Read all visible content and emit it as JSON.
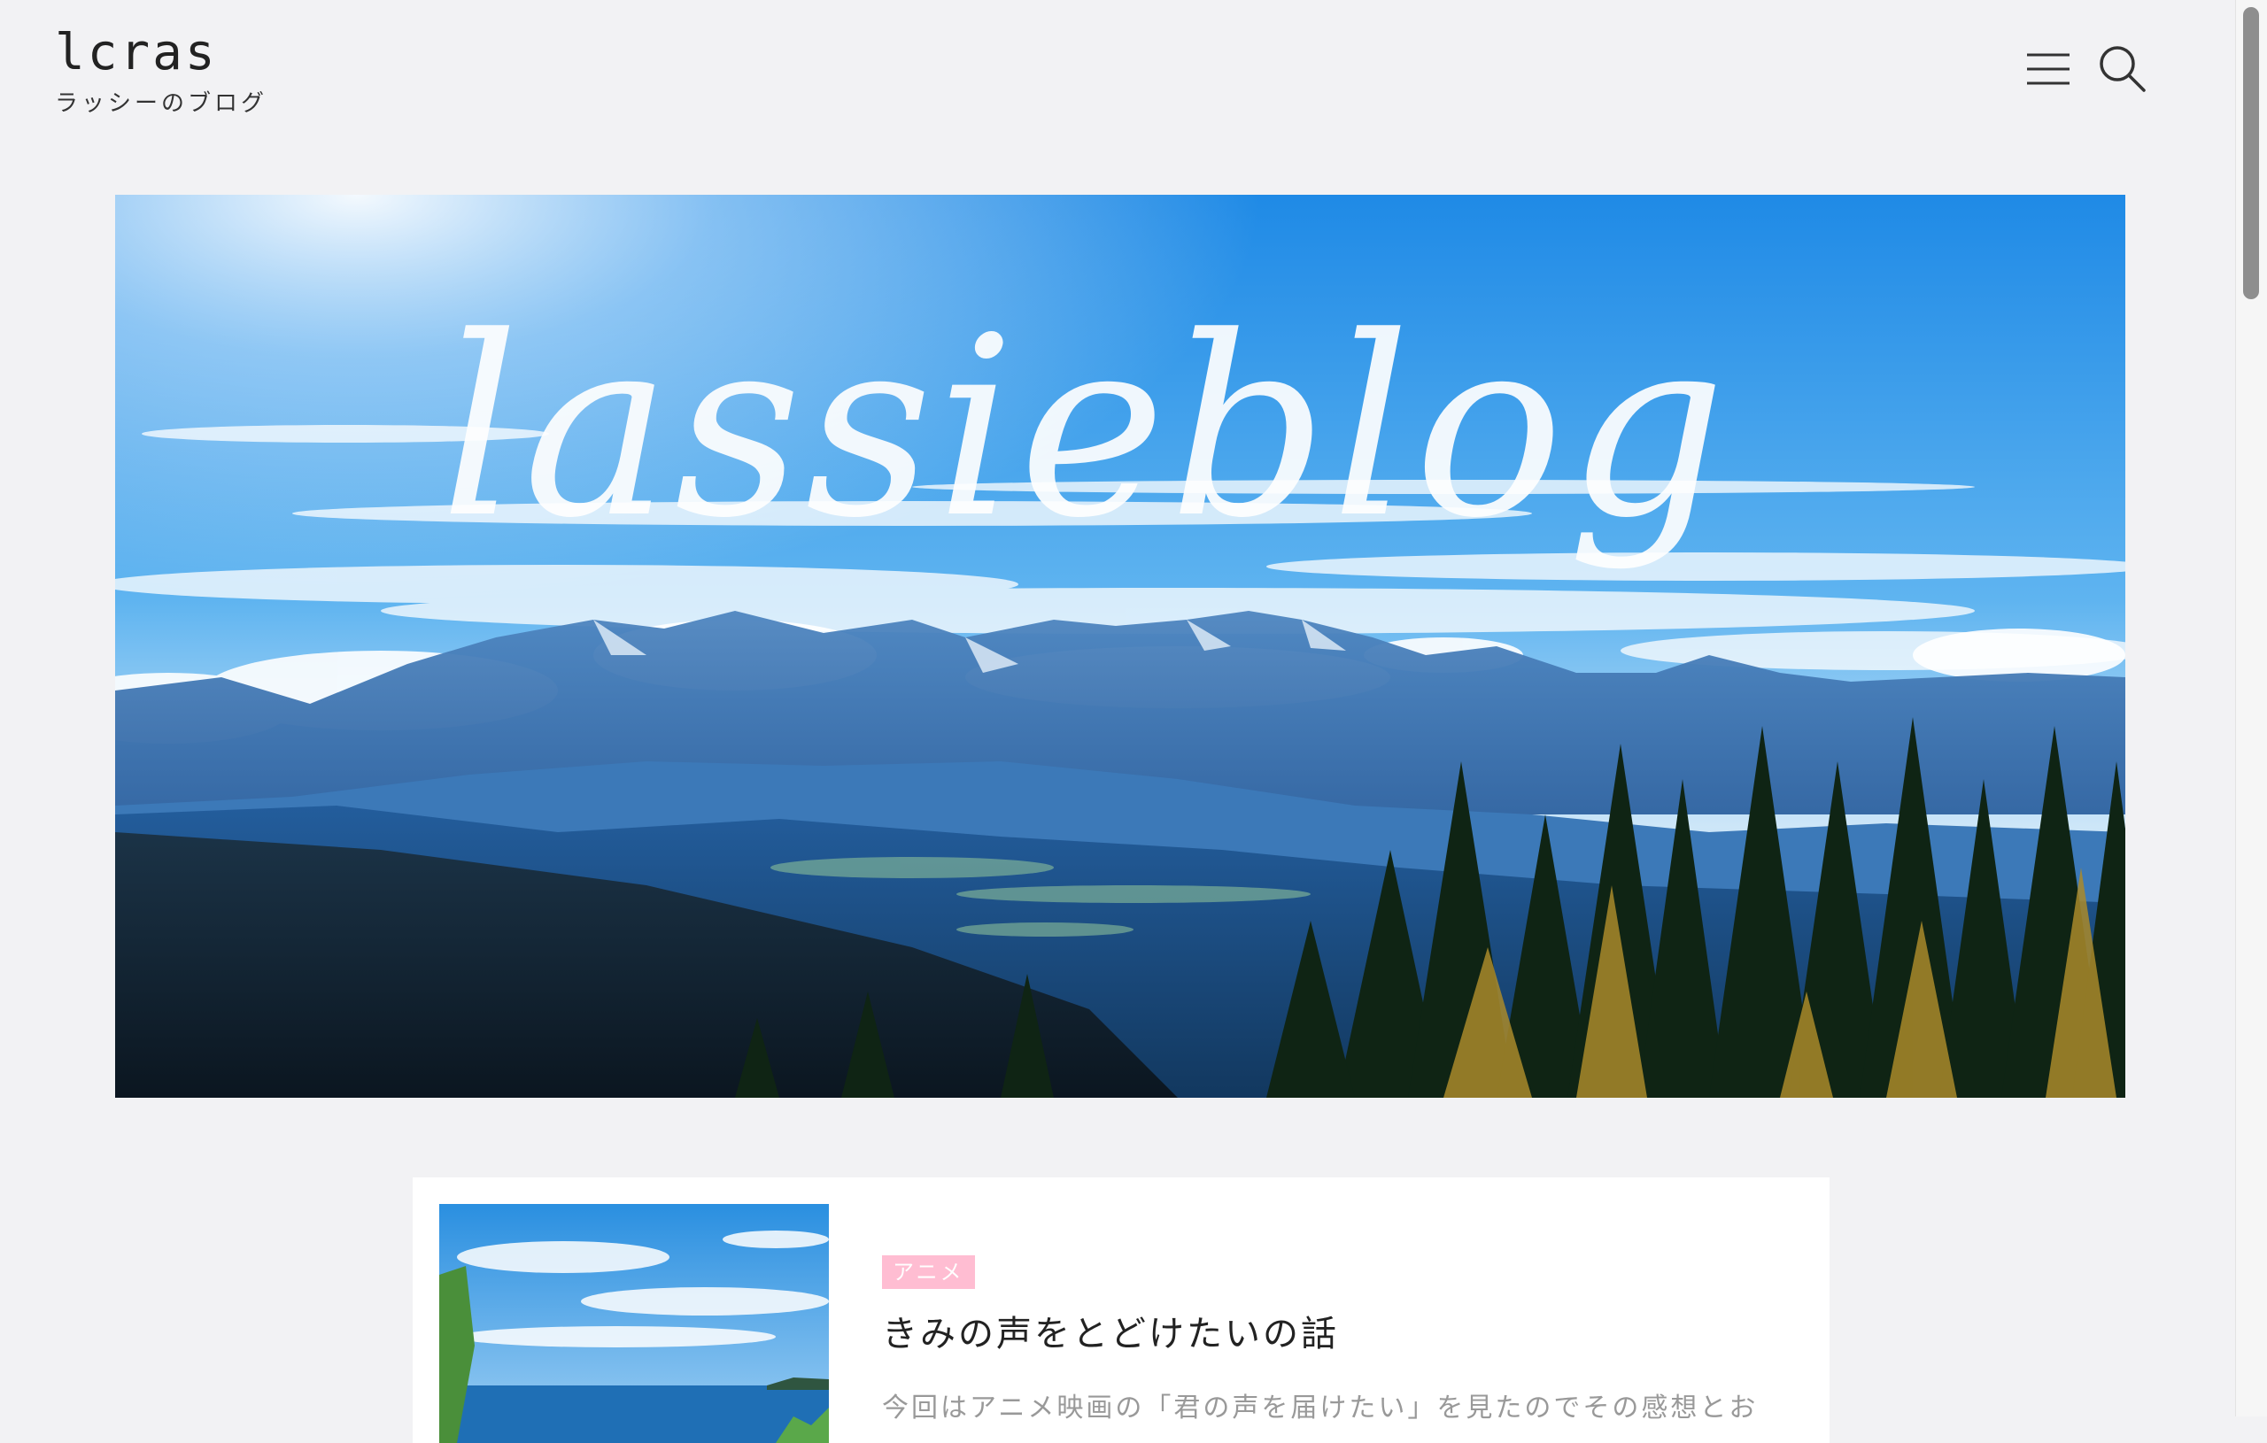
{
  "header": {
    "logo": "lcras",
    "tagline": "ラッシーのブログ",
    "menu_icon": "hamburger-icon",
    "search_icon": "search-icon"
  },
  "hero": {
    "title_script": "lassieblog"
  },
  "post": {
    "category": "アニメ",
    "title": "きみの声をとどけたいの話",
    "excerpt": "今回はアニメ映画の「君の声を届けたい」を見たのでその感想とお"
  },
  "colors": {
    "background": "#f2f2f4",
    "category_badge": "#ffbdd2",
    "card": "#ffffff"
  }
}
